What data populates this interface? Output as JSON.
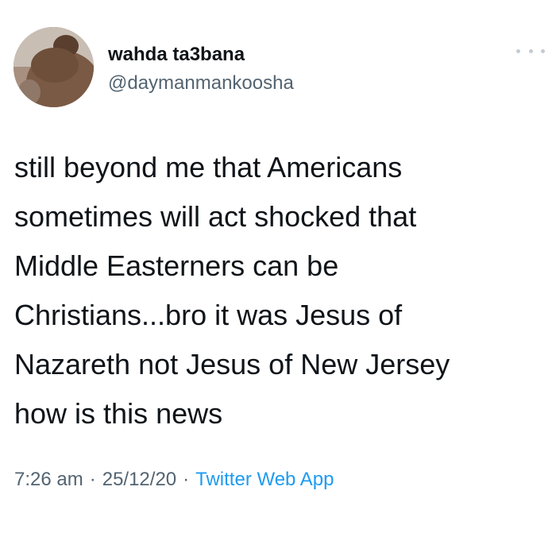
{
  "user": {
    "display_name": "wahda ta3bana",
    "handle": "@daymanmankoosha"
  },
  "more_icon": "ellipsis-icon",
  "tweet": {
    "lines": [
      "still beyond me that Americans",
      "sometimes will act shocked that",
      "Middle Easterners can be",
      "Christians...bro it was Jesus of",
      "Nazareth not Jesus of New Jersey",
      "how is this news"
    ]
  },
  "meta": {
    "time": "7:26 am",
    "separator": "·",
    "date": "25/12/20",
    "source": "Twitter Web App"
  },
  "colors": {
    "text": "#0f1419",
    "secondary": "#536471",
    "link": "#1d9bf0",
    "background": "#ffffff"
  }
}
